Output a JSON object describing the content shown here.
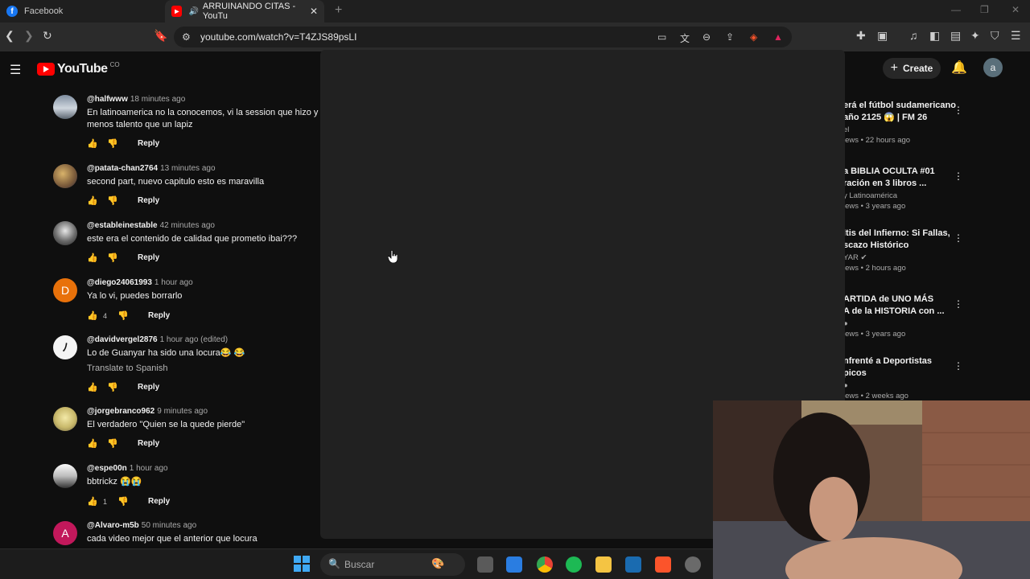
{
  "browser": {
    "tabs": [
      {
        "title": "Facebook"
      },
      {
        "title": "ARRUINANDO CITAS - YouTu"
      }
    ],
    "url": "youtube.com/watch?v=T4ZJS89psLI"
  },
  "youtube": {
    "logo_text": "YouTube",
    "logo_country": "CO",
    "create_label": "Create",
    "account_initial": "a"
  },
  "comments": [
    {
      "user": "@halfwww",
      "time": "18 minutes ago",
      "lines": [
        "En latinoamerica no la conocemos, vi la session que hizo y me",
        "menos talento que un lapiz"
      ],
      "likes": "",
      "reply": "Reply"
    },
    {
      "user": "@patata-chan2764",
      "time": "13 minutes ago",
      "lines": [
        "second part, nuevo capitulo esto es maravilla"
      ],
      "likes": "",
      "reply": "Reply"
    },
    {
      "user": "@estableinestable",
      "time": "42 minutes ago",
      "lines": [
        "este era el contenido de calidad que prometio ibai???"
      ],
      "likes": "",
      "reply": "Reply"
    },
    {
      "user": "@diego24061993",
      "time": "1 hour ago",
      "lines": [
        "Ya lo vi, puedes borrarlo"
      ],
      "likes": "4",
      "reply": "Reply",
      "avatar_letter": "D"
    },
    {
      "user": "@davidvergel2876",
      "time": "1 hour ago (edited)",
      "lines": [
        "Lo de Guanyar ha sido una locura😂 😂"
      ],
      "translate": "Translate to Spanish",
      "likes": "",
      "reply": "Reply"
    },
    {
      "user": "@jorgebranco962",
      "time": "9 minutes ago",
      "lines": [
        "El verdadero \"Quien se la quede pierde\""
      ],
      "likes": "",
      "reply": "Reply"
    },
    {
      "user": "@espe00n",
      "time": "1 hour ago",
      "lines": [
        "bbtrickz 😭😭"
      ],
      "likes": "1",
      "reply": "Reply"
    },
    {
      "user": "@Alvaro-m5b",
      "time": "50 minutes ago",
      "lines": [
        "cada video mejor que el anterior que locura"
      ],
      "likes": "",
      "reply": "Reply",
      "avatar_letter": "A"
    }
  ],
  "recommendations": [
    {
      "title1": "erá el fútbol sudamericano",
      "title2": "año 2125 😱 | FM 26",
      "channel": "el",
      "meta": "iews • 22 hours ago"
    },
    {
      "title1": "a BIBLIA OCULTA #01",
      "title2": "ración en 3 libros ...",
      "channel": "y Latinoamérica",
      "meta": "iews • 3 years ago"
    },
    {
      "title1": "ltis del Infierno: Si Fallas,",
      "title2": "scazo Histórico",
      "channel": "YAR",
      "meta": "iews • 2 hours ago"
    },
    {
      "title1": "ARTIDA de UNO MÁS",
      "title2": "A de la HISTORIA con ...",
      "channel": "",
      "meta": "iews • 3 years ago"
    },
    {
      "title1": "nfrenté a Deportistas",
      "title2": "picos",
      "channel": "",
      "meta": "iews • 2 weeks ago"
    }
  ],
  "taskbar": {
    "search_placeholder": "Buscar"
  },
  "colors": {
    "background": "#0f0f0f",
    "overlay": "#212121",
    "youtube_red": "#ff0000"
  }
}
